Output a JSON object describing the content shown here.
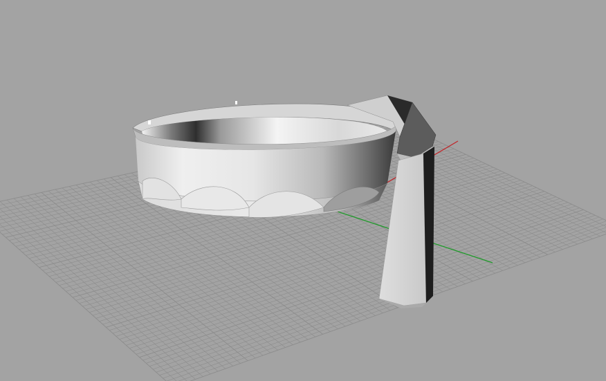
{
  "viewport": {
    "kind": "3d-perspective-viewport",
    "background_color": "#a3a3a3",
    "grid_color": "#8c8c8c",
    "x_axis_color": "#c0262a",
    "y_axis_color": "#1f9a2a",
    "shading": "grayscale",
    "model": {
      "parts": [
        "ring-holder-body",
        "scalloped-base",
        "handle-arm"
      ],
      "scallop_count": 4
    }
  }
}
